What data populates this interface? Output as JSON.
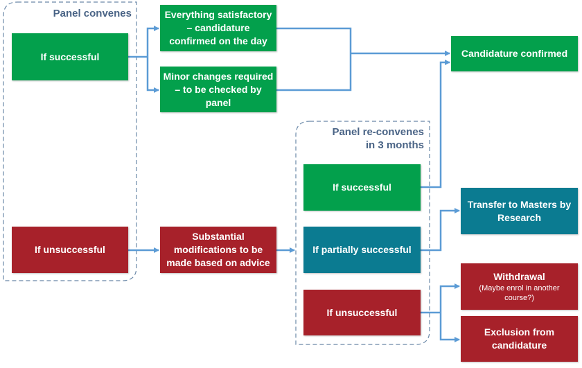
{
  "colors": {
    "success": "#03a04c",
    "partial": "#0b7b91",
    "failure": "#a7212a",
    "connector": "#5b9bd5",
    "panel_title": "#4a6486"
  },
  "panel1": {
    "title": "Panel convenes",
    "if_successful": "If successful",
    "if_unsuccessful": "If unsuccessful"
  },
  "outcomes1": {
    "everything_satisfactory": "Everything satisfactory – candidature confirmed on the day",
    "minor_changes": "Minor changes required – to be checked by panel",
    "substantial_modifications": "Substantial modifications to be made based on advice"
  },
  "panel2": {
    "title_line1": "Panel re-convenes",
    "title_line2": "in 3 months",
    "if_successful": "If successful",
    "if_partially_successful": "If partially successful",
    "if_unsuccessful": "If unsuccessful"
  },
  "final": {
    "candidature_confirmed": "Candidature confirmed",
    "transfer": "Transfer to Masters by Research",
    "withdrawal": "Withdrawal",
    "withdrawal_note": "(Maybe enrol in another course?)",
    "exclusion": "Exclusion from candidature"
  }
}
